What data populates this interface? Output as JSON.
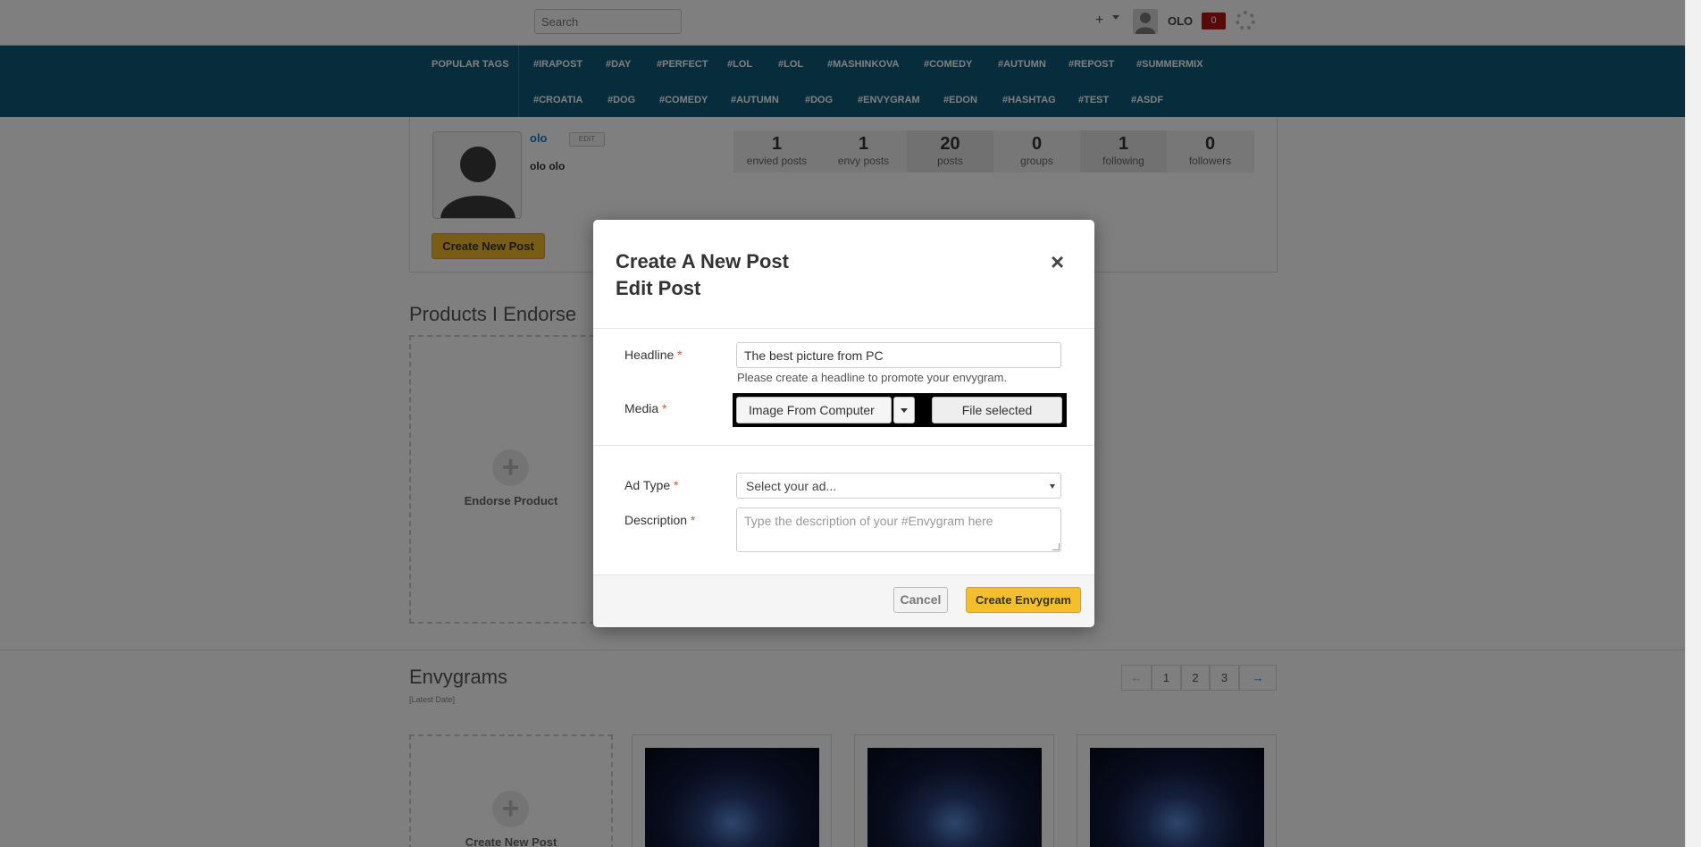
{
  "topbar": {
    "search_placeholder": "Search",
    "plus_glyph": "+",
    "username": "OLO",
    "notification_count": "0"
  },
  "tags": {
    "label": "POPULAR TAGS",
    "row1": [
      "#IRAPOST",
      "#DAY",
      "#PERFECT",
      "#LOL",
      "#LOL",
      "#MASHINKOVA",
      "#COMEDY",
      "#AUTUMN",
      "#REPOST",
      "#SUMMERMIX"
    ],
    "row2": [
      "#CROATIA",
      "#DOG",
      "#COMEDY",
      "#AUTUMN",
      "#DOG",
      "#ENVYGRAM",
      "#EDON",
      "#HASHTAG",
      "#TEST",
      "#ASDF"
    ]
  },
  "profile": {
    "name": "olo",
    "edit_label": "EDIT",
    "full_name": "olo olo",
    "create_label": "Create New Post",
    "stats": [
      {
        "num": "1",
        "label": "envied posts"
      },
      {
        "num": "1",
        "label": "envy posts"
      },
      {
        "num": "20",
        "label": "posts"
      },
      {
        "num": "0",
        "label": "groups"
      },
      {
        "num": "1",
        "label": "following"
      },
      {
        "num": "0",
        "label": "followers"
      }
    ]
  },
  "products": {
    "title": "Products I Endorse",
    "endorse_label": "Endorse Product",
    "plus_glyph": "+"
  },
  "envygrams": {
    "title": "Envygrams",
    "subtitle": "[Latest Date]",
    "add_label": "Create New Post",
    "plus_glyph": "+",
    "pager": [
      "←",
      "1",
      "2",
      "3",
      "→"
    ]
  },
  "modal": {
    "title_line1": "Create A New Post",
    "title_line2": "Edit Post",
    "close_glyph": "×",
    "headline_label": "Headline",
    "required_mark": "*",
    "headline_value": "The best picture from PC",
    "headline_help": "Please create a headline to promote your envygram.",
    "media_label": "Media",
    "media_source": "Image From Computer",
    "file_button": "File selected",
    "adtype_label": "Ad Type",
    "adtype_value": "Select your ad...",
    "description_label": "Description",
    "description_placeholder": "Type the description of your #Envygram here",
    "cancel_label": "Cancel",
    "create_label": "Create Envygram"
  },
  "colors": {
    "nav_bg": "#0f5a78",
    "accent_yellow": "#f5bf2c",
    "required_red": "#d9534f",
    "badge_red": "#b3140e"
  }
}
